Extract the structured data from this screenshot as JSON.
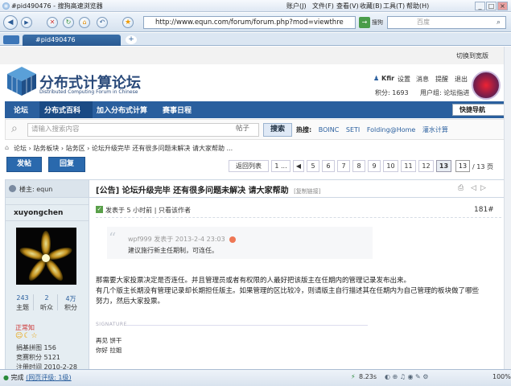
{
  "browser": {
    "title": "#pid490476 - 搜狗高速浏览器",
    "menu": [
      "账户(J)",
      "文件(F)",
      "查看(V)",
      "收藏(B)",
      "工具(T)",
      "帮助(H)"
    ],
    "window_buttons": [
      "_",
      "□",
      "×"
    ],
    "url": "http://www.equn.com/forum/forum.php?mod=viewthre",
    "search_engine": "搜狗",
    "search_placeholder": "百度",
    "tab_label": "#pid490476",
    "status_text": "完成",
    "status_link": "(网页评级: 1级)",
    "status_speed": "8.23s",
    "zoom": "100%"
  },
  "site": {
    "skin_switch": "切换到宽版",
    "logo_title": "分布式计算论坛",
    "logo_sub": "Distributed Computing Forum in Chinese",
    "user": {
      "name": "Kfir",
      "settings": "设置",
      "messages": "消息",
      "reminders": "提醒",
      "logout": "退出",
      "points": "积分: 1693",
      "group": "用户组: 论坛指进"
    },
    "nav": [
      "论坛",
      "分布式百科",
      "加入分布式计算",
      "赛事日程"
    ],
    "quick_nav": "快捷导航",
    "search": {
      "placeholder": "请输入搜索内容",
      "type": "帖子",
      "button": "搜索",
      "hot_label": "热搜:",
      "hot_items": [
        "BOINC",
        "SETI",
        "Folding@Home",
        "灌水计算"
      ]
    },
    "breadcrumb": "论坛 › 站务板块 › 站务区 › 论坛升级完毕 还有很多问题未解决 请大家帮助 ...",
    "post_button": "发帖",
    "reply_button": "回复",
    "pagination": {
      "back": "返回列表",
      "first": "1 ...",
      "pages": [
        "5",
        "6",
        "7",
        "8",
        "9",
        "10",
        "11",
        "12",
        "13"
      ],
      "current": "13",
      "input": "13",
      "total": "/ 13 页"
    }
  },
  "thread": {
    "op_label": "楼主: equn",
    "title": "[公告] 论坛升级完毕 还有很多问题未解决 请大家帮助",
    "copy_link": "[复制链接]",
    "post": {
      "author": "xuyongchen",
      "stats": [
        {
          "value": "243",
          "label": "主题"
        },
        {
          "value": "2",
          "label": "听众"
        },
        {
          "value": "4万",
          "label": "积分"
        }
      ],
      "rank": "正常知",
      "info": [
        "捐基拼图  156",
        "竞赛积分  5121",
        "注册时间  2010-2-28"
      ],
      "meta": "发表于 5 小时前  |  只看该作者",
      "floor": "181#",
      "quote_meta": "wpf999 发表于 2013-2-4 23:03",
      "quote_text": "建议施行新主任期制，可连任。",
      "body": [
        "那需要大家投票决定是否连任。并且管理员或者有权限的人最好把该版主在任期内的管理记录发布出来。",
        "有几个版主长期没有管理记录却长期担任版主。如果管理的区比较冷，则请版主自行描述其在任期内为自己管理的板块做了哪些",
        "努力，然后大家投票。"
      ],
      "signature_label": "SIGNATURE",
      "signature": [
        "再见 饼干",
        "你好 拉姐"
      ]
    }
  },
  "colors": {
    "brand_blue": "#2a5f9e",
    "link_blue": "#2a5f9e"
  }
}
